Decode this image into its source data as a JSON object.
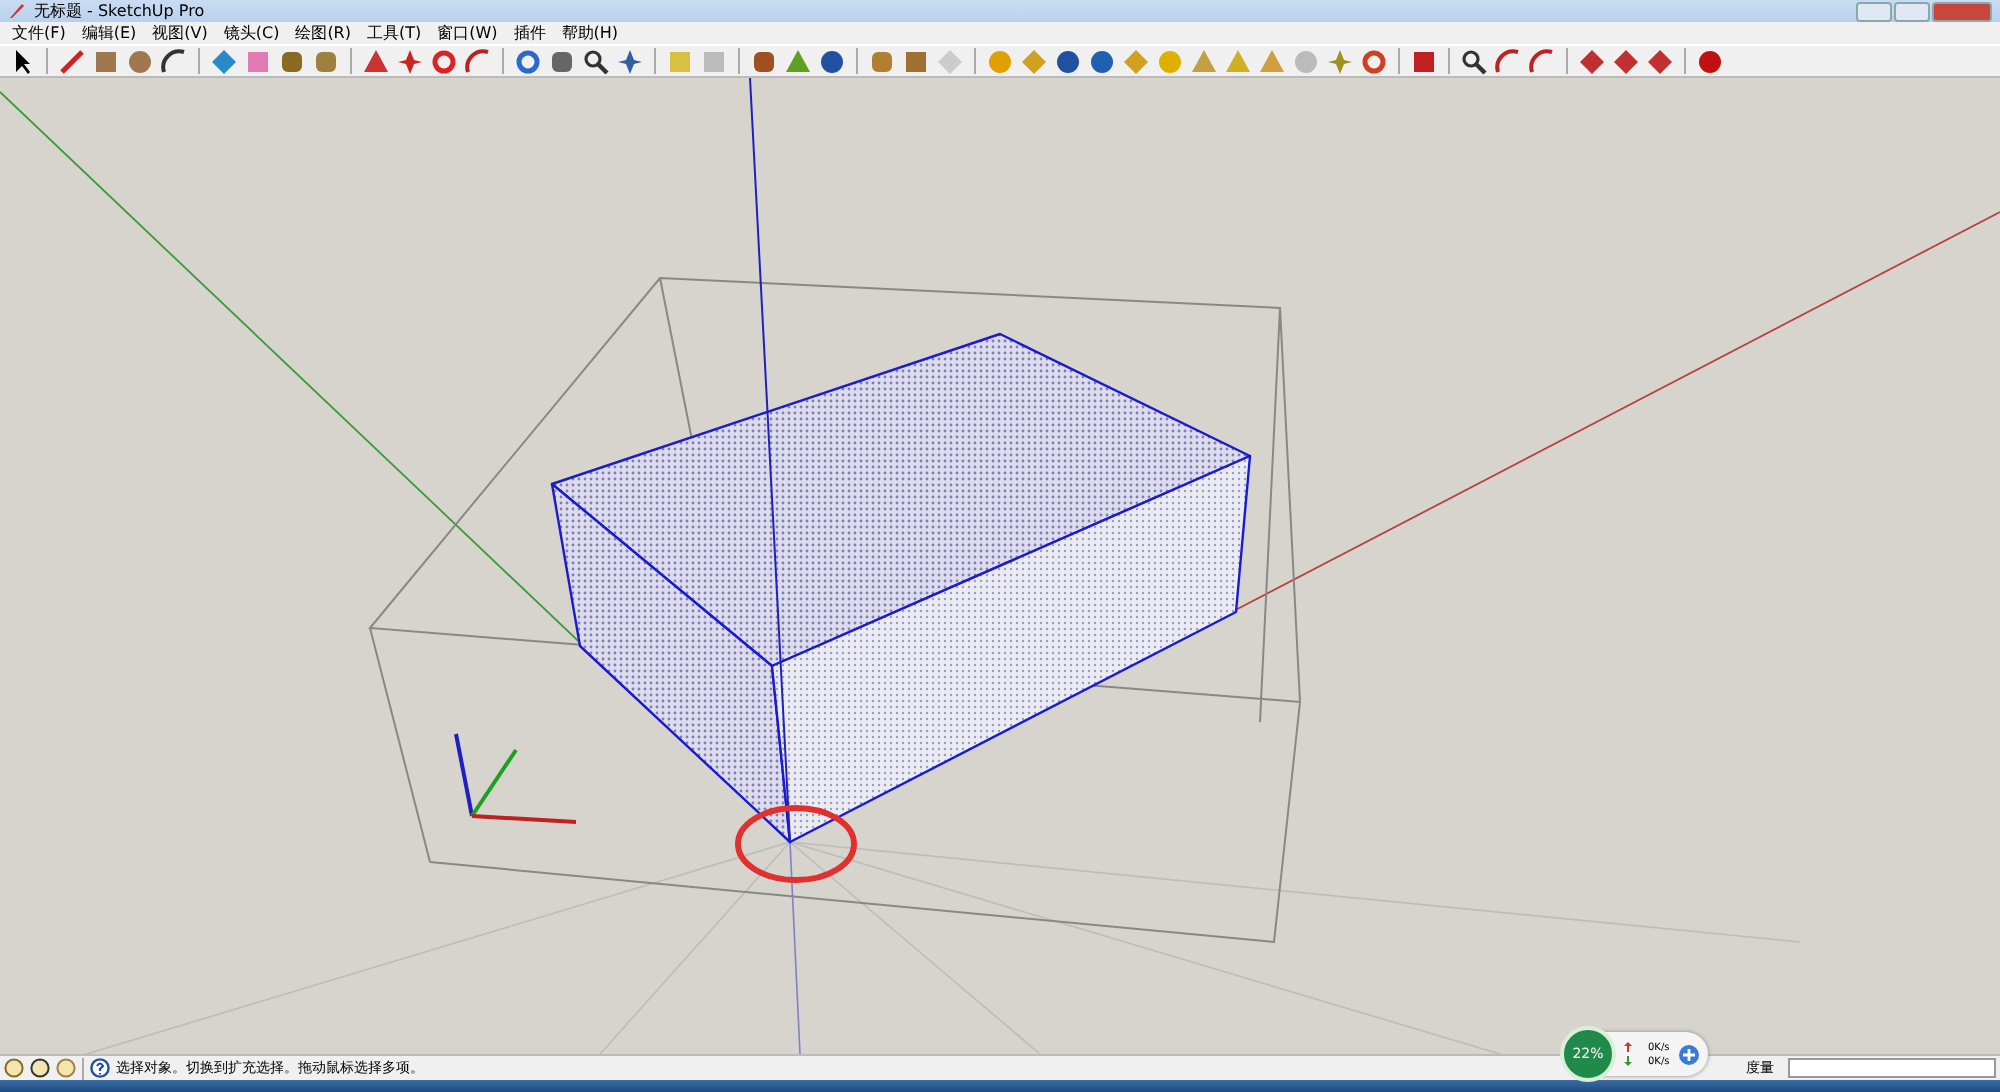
{
  "window": {
    "title": "无标题 - SketchUp Pro"
  },
  "menu": [
    {
      "label": "文件(F)"
    },
    {
      "label": "编辑(E)"
    },
    {
      "label": "视图(V)"
    },
    {
      "label": "镜头(C)"
    },
    {
      "label": "绘图(R)"
    },
    {
      "label": "工具(T)"
    },
    {
      "label": "窗口(W)"
    },
    {
      "label": "插件"
    },
    {
      "label": "帮助(H)"
    }
  ],
  "status_bar": {
    "message": "选择对象。切换到扩充选择。拖动鼠标选择多项。",
    "measure_label": "度量"
  },
  "network_gadget": {
    "percent": "22%",
    "upload": "0K/s",
    "download": "0K/s"
  }
}
